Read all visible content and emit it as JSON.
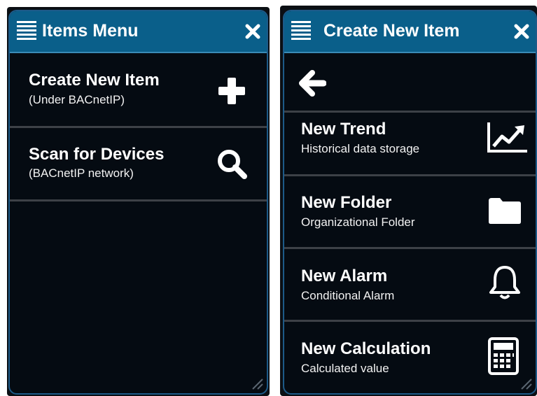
{
  "left_panel": {
    "title": "Items Menu",
    "items": [
      {
        "title": "Create New Item",
        "subtitle": "(Under BACnetIP)",
        "icon": "plus-icon"
      },
      {
        "title": "Scan for Devices",
        "subtitle": "(BACnetIP network)",
        "icon": "search-icon"
      }
    ]
  },
  "right_panel": {
    "title": "Create New Item",
    "back_icon": "arrow-left-icon",
    "items": [
      {
        "title": "New Trend",
        "subtitle": "Historical data storage",
        "icon": "trend-chart-icon"
      },
      {
        "title": "New Folder",
        "subtitle": "Organizational Folder",
        "icon": "folder-icon"
      },
      {
        "title": "New Alarm",
        "subtitle": "Conditional Alarm",
        "icon": "bell-icon"
      },
      {
        "title": "New Calculation",
        "subtitle": "Calculated value",
        "icon": "calculator-icon"
      }
    ]
  },
  "colors": {
    "panel_bg": "#050b12",
    "titlebar_bg": "#0a5f8a",
    "border": "#1d5a88",
    "divider": "#3d4147",
    "text": "#ffffff"
  }
}
